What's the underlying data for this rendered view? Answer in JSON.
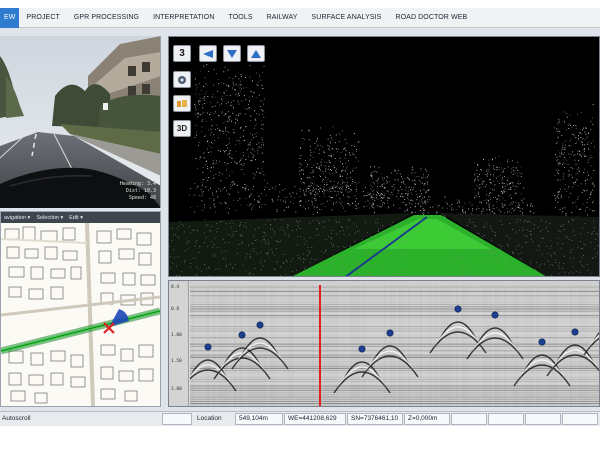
{
  "menu": {
    "items": [
      {
        "label": "EW",
        "active": true
      },
      {
        "label": "PROJECT"
      },
      {
        "label": "GPR PROCESSING"
      },
      {
        "label": "INTERPRETATION"
      },
      {
        "label": "TOOLS"
      },
      {
        "label": "RAILWAY"
      },
      {
        "label": "SURFACE ANALYSIS"
      },
      {
        "label": "ROAD DOCTOR WEB"
      }
    ]
  },
  "camera": {
    "overlay": [
      "Heading: 3.4",
      "Dist: 10.3",
      "Speed: 48"
    ]
  },
  "map": {
    "toolbar": [
      "avigation ▾",
      "Selection ▾",
      "Edit ▾"
    ]
  },
  "pointcloud": {
    "tools": {
      "mode_3": "3",
      "mode_3d": "3D"
    }
  },
  "gpr": {
    "depth_ticks": [
      "0.4",
      "0.8",
      "1.00",
      "1.50",
      "2.00"
    ]
  },
  "status": {
    "autoscroll_label": "Autoscroll",
    "location_label": "Location",
    "location_value": "549,104m",
    "we_value": "WE=441208,629",
    "sn_value": "SN=7376461,10",
    "z_value": "Z=0,000m"
  },
  "colors": {
    "accent": "#2f7bcf",
    "ground_green": "#3bbf2e",
    "cursor_red": "#e0201c",
    "marker_blue": "#1c3f8f"
  }
}
